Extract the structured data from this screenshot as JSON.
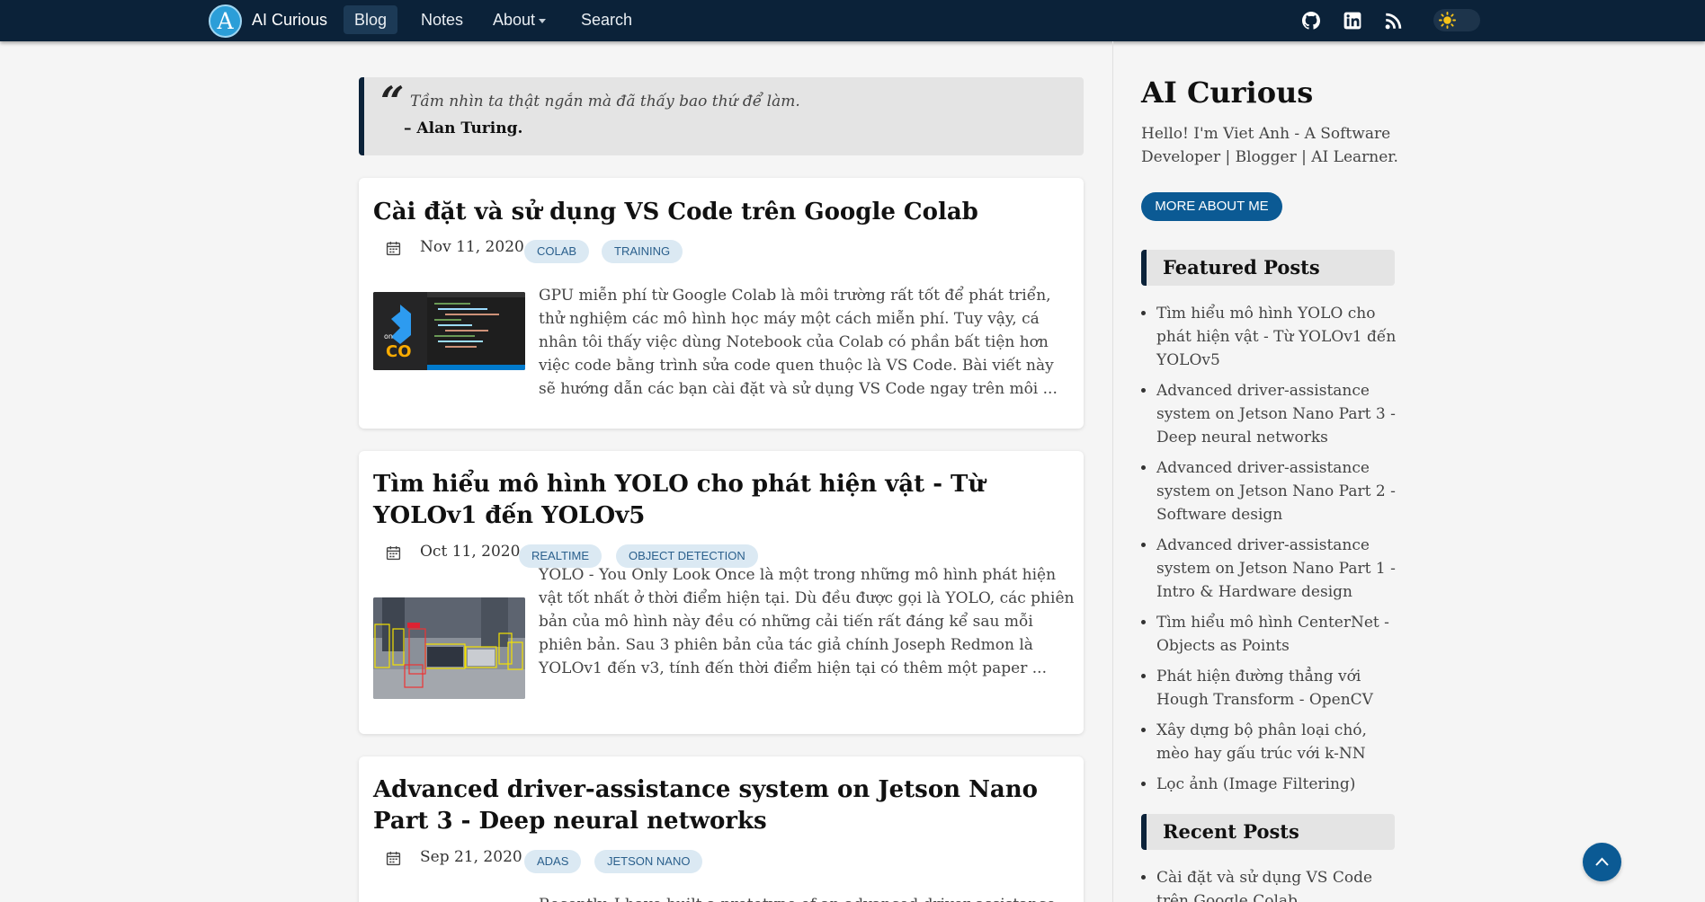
{
  "header": {
    "logo_letter": "A",
    "brand": "AI Curious",
    "nav": [
      {
        "label": "Blog"
      },
      {
        "label": "Notes"
      },
      {
        "label": "About"
      },
      {
        "label": "Search"
      }
    ],
    "icons": [
      "github-icon",
      "linkedin-icon",
      "rss-icon",
      "sun-icon"
    ]
  },
  "quote": {
    "text": "Tầm nhìn ta thật ngắn mà đã thấy bao thứ để làm.",
    "author": "– Alan Turing."
  },
  "posts": [
    {
      "title": "Cài đặt và sử dụng VS Code trên Google Colab",
      "date": "Nov 11, 2020",
      "tags": [
        "COLAB",
        "TRAINING"
      ],
      "excerpt": "GPU miễn phí từ Google Colab là môi trường rất tốt để phát triển, thử nghiệm các mô hình học máy một cách miễn phí. Tuy vậy, cá nhân tôi thấy việc dùng Notebook của Colab có phần bất tiện hơn việc code bằng trình sửa code quen thuộc là VS Code. Bài viết này sẽ hướng dẫn các bạn cài đặt và sử dụng VS Code ngay trên môi ...",
      "thumb_text": [
        "on",
        "CO"
      ]
    },
    {
      "title": "Tìm hiểu mô hình YOLO cho phát hiện vật - Từ YOLOv1 đến YOLOv5",
      "date": "Oct 11, 2020",
      "tags": [
        "REALTIME",
        "OBJECT DETECTION"
      ],
      "excerpt": "YOLO - You Only Look Once là một trong những mô hình phát hiện vật tốt nhất ở thời điểm hiện tại. Dù đều được gọi là YOLO, các phiên bản của mô hình này đều có những cải tiến rất đáng kể sau mỗi phiên bản. Sau 3 phiên bản của tác giả chính Joseph Redmon là YOLOv1 đến v3, tính đến thời điểm hiện tại có thêm một paper ..."
    },
    {
      "title": "Advanced driver-assistance system on Jetson Nano Part 3 - Deep neural networks",
      "date": "Sep 21, 2020",
      "tags": [
        "ADAS",
        "JETSON NANO"
      ],
      "excerpt": "Recently, I have built a prototype of an advanced driver-assistance"
    }
  ],
  "sidebar": {
    "title": "AI Curious",
    "description": "Hello! I'm Viet Anh - A Software Developer | Blogger | AI Learner.",
    "more_button": "MORE ABOUT ME",
    "featured_heading": "Featured Posts",
    "featured": [
      "Tìm hiểu mô hình YOLO cho phát hiện vật - Từ YOLOv1 đến YOLOv5",
      "Advanced driver-assistance system on Jetson Nano Part 3 - Deep neural networks",
      "Advanced driver-assistance system on Jetson Nano Part 2 - Software design",
      "Advanced driver-assistance system on Jetson Nano Part 1 - Intro & Hardware design",
      "Tìm hiểu mô hình CenterNet - Objects as Points",
      "Phát hiện đường thẳng với Hough Transform - OpenCV",
      "Xây dựng bộ phân loại chó, mèo hay gấu trúc với k-NN",
      "Lọc ảnh (Image Filtering)"
    ],
    "recent_heading": "Recent Posts",
    "recent": [
      "Cài đặt và sử dụng VS Code trên Google Colab"
    ]
  },
  "colors": {
    "header_bg": "#0b2239",
    "accent": "#0b5a94",
    "tag_bg": "#dbe9f3",
    "tag_text": "#2a5f8c"
  }
}
